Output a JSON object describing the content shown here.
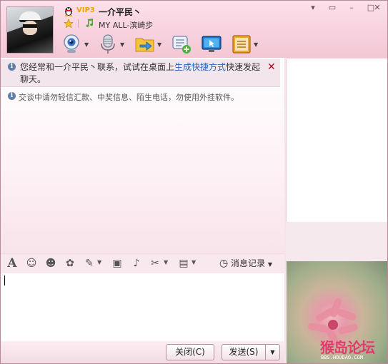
{
  "window": {
    "controls": {
      "menu": "▾",
      "skin": "▭",
      "minimize": "–",
      "maximize": "□",
      "close": "✕"
    }
  },
  "contact": {
    "vip_badge": "VIP3",
    "nickname": "一介平民丶",
    "signature": "MY ALL-滨崎步",
    "icons": [
      "qq-penguin-icon",
      "star-icon",
      "music-icon"
    ]
  },
  "toolbar": {
    "items": [
      {
        "name": "video-call",
        "icon": "webcam-icon",
        "has_dropdown": true
      },
      {
        "name": "voice-call",
        "icon": "microphone-icon",
        "has_dropdown": true
      },
      {
        "name": "send-file",
        "icon": "folder-transfer-icon",
        "has_dropdown": true
      },
      {
        "name": "create-discussion",
        "icon": "chat-add-icon",
        "has_dropdown": false
      },
      {
        "name": "remote-assist",
        "icon": "monitor-icon",
        "has_dropdown": false
      },
      {
        "name": "app-box",
        "icon": "app-box-icon",
        "has_dropdown": true
      }
    ],
    "dropdown_glyph": "▼"
  },
  "tip": {
    "text_before": "您经常和一介平民丶联系，试试在桌面上",
    "link": "生成快捷方式",
    "text_after": "快速发起聊天。",
    "close": "✕",
    "info_glyph": "i"
  },
  "warning": {
    "text": "交谈中请勿轻信汇款、中奖信息、陌生电话，勿使用外挂软件。",
    "info_glyph": "i"
  },
  "input_toolbar": {
    "items": [
      "font-icon",
      "emoticon-icon",
      "magic-emoticon-icon",
      "shake-icon",
      "doodle-icon",
      "image-icon",
      "music-note-icon",
      "screenshot-icon",
      "briefcase-icon"
    ],
    "glyphs": {
      "font": "A",
      "emoticon": "☺",
      "magic": "☻",
      "shake": "✿",
      "doodle": "✎",
      "image": "▣",
      "music": "♪",
      "screenshot": "✂",
      "briefcase": "▤",
      "clock": "◷"
    },
    "history_label": "消息记录",
    "dropdown_glyph": "▼"
  },
  "buttons": {
    "close_label": "关闭(C)",
    "send_label": "发送(S)",
    "send_dropdown": "▼"
  },
  "watermark": {
    "title": "猴岛论坛",
    "url": "BBS.HOUDAO.COM"
  },
  "colors": {
    "accent_pink": "#f4c6d4",
    "link_blue": "#2c63b8",
    "close_red": "#b00012",
    "watermark_pink": "#e23a6f"
  }
}
